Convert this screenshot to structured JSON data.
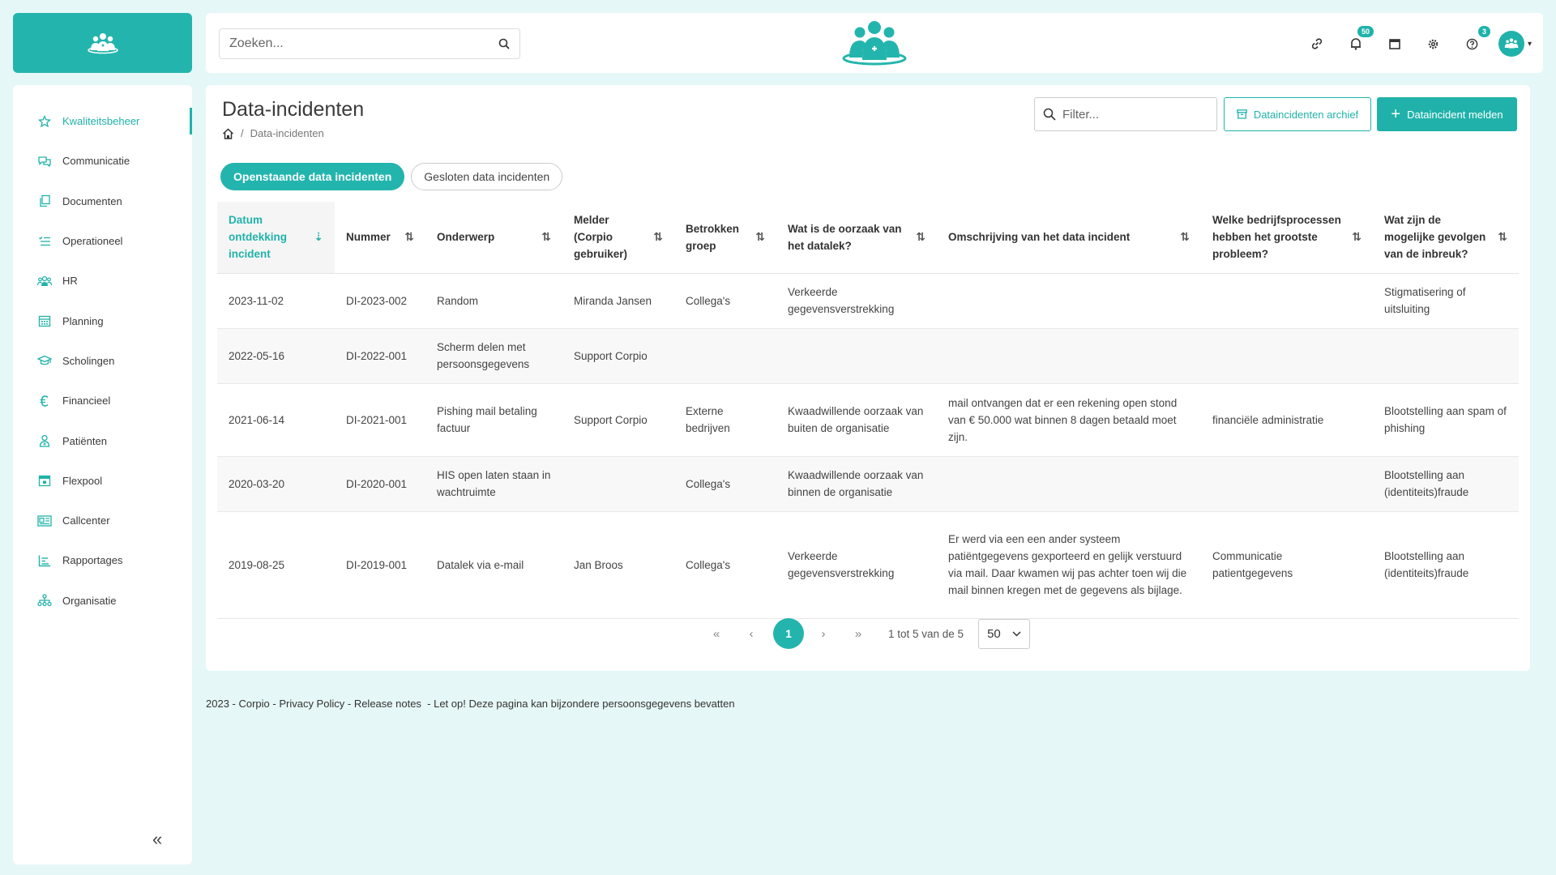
{
  "sidebar": {
    "items": [
      {
        "label": "Kwaliteitsbeheer",
        "icon": "star-icon",
        "active": true
      },
      {
        "label": "Communicatie",
        "icon": "chat-icon"
      },
      {
        "label": "Documenten",
        "icon": "documents-icon"
      },
      {
        "label": "Operationeel",
        "icon": "checklist-icon"
      },
      {
        "label": "HR",
        "icon": "people-icon"
      },
      {
        "label": "Planning",
        "icon": "calendar-icon"
      },
      {
        "label": "Scholingen",
        "icon": "graduation-cap-icon"
      },
      {
        "label": "Financieel",
        "icon": "euro-icon"
      },
      {
        "label": "Patiënten",
        "icon": "patient-icon"
      },
      {
        "label": "Flexpool",
        "icon": "calendar-add-icon"
      },
      {
        "label": "Callcenter",
        "icon": "newspaper-icon"
      },
      {
        "label": "Rapportages",
        "icon": "report-icon"
      },
      {
        "label": "Organisatie",
        "icon": "org-chart-icon"
      }
    ],
    "collapse_label": "«"
  },
  "topbar": {
    "search_placeholder": "Zoeken...",
    "notifications_badge": "50",
    "help_badge": "3"
  },
  "page": {
    "title": "Data-incidenten",
    "breadcrumb_current": "Data-incidenten",
    "breadcrumb_sep": "/",
    "filter_placeholder": "Filter...",
    "archive_button": "Dataincidenten archief",
    "report_button": "Dataincident melden",
    "tabs": [
      {
        "label": "Openstaande data incidenten",
        "active": true
      },
      {
        "label": "Gesloten data incidenten",
        "active": false
      }
    ]
  },
  "table": {
    "columns": [
      "Datum ontdekking incident",
      "Nummer",
      "Onderwerp",
      "Melder (Corpio gebruiker)",
      "Betrokken groep",
      "Wat is de oorzaak van het datalek?",
      "Omschrijving van het data incident",
      "Welke bedrijfsprocessen hebben het grootste probleem?",
      "Wat zijn de mogelijke gevolgen van de inbreuk?"
    ],
    "rows": [
      [
        "2023-11-02",
        "DI-2023-002",
        "Random",
        "Miranda Jansen",
        "Collega's",
        "Verkeerde gegevensverstrekking",
        "",
        "",
        "Stigmatisering of uitsluiting"
      ],
      [
        "2022-05-16",
        "DI-2022-001",
        "Scherm delen met persoonsgegevens",
        "Support Corpio",
        "",
        "",
        "",
        "",
        ""
      ],
      [
        "2021-06-14",
        "DI-2021-001",
        "Pishing mail betaling factuur",
        "Support Corpio",
        "Externe bedrijven",
        "Kwaadwillende oorzaak van buiten de organisatie",
        "mail ontvangen dat er een rekening open stond van € 50.000 wat binnen 8 dagen betaald moet zijn.",
        "financiële administratie",
        "Blootstelling aan spam of phishing"
      ],
      [
        "2020-03-20",
        "DI-2020-001",
        "HIS open laten staan in wachtruimte",
        "",
        "Collega's",
        "Kwaadwillende oorzaak van binnen de organisatie",
        "",
        "",
        "Blootstelling aan (identiteits)fraude"
      ],
      [
        "2019-08-25",
        "DI-2019-001",
        "Datalek via e-mail",
        "Jan Broos",
        "Collega's",
        "Verkeerde gegevensverstrekking",
        "Er werd via een een ander systeem patiëntgegevens gexporteerd en gelijk verstuurd via mail. Daar kwamen wij pas achter toen wij die mail binnen kregen met de gegevens als bijlage.",
        "Communicatie patientgegevens",
        "Blootstelling aan (identiteits)fraude"
      ]
    ]
  },
  "pagination": {
    "first": "«",
    "prev": "‹",
    "current": "1",
    "next": "›",
    "last": "»",
    "info": "1 tot 5 van de 5",
    "page_size": "50"
  },
  "footer": {
    "year_brand": "2023 - Corpio - ",
    "privacy": "Privacy Policy",
    "sep": " - ",
    "release": "Release notes",
    "warning": "  - Let op! Deze pagina kan bijzondere persoonsgegevens bevatten"
  },
  "colors": {
    "accent": "#23b5ad",
    "background": "#e6f7f7"
  }
}
